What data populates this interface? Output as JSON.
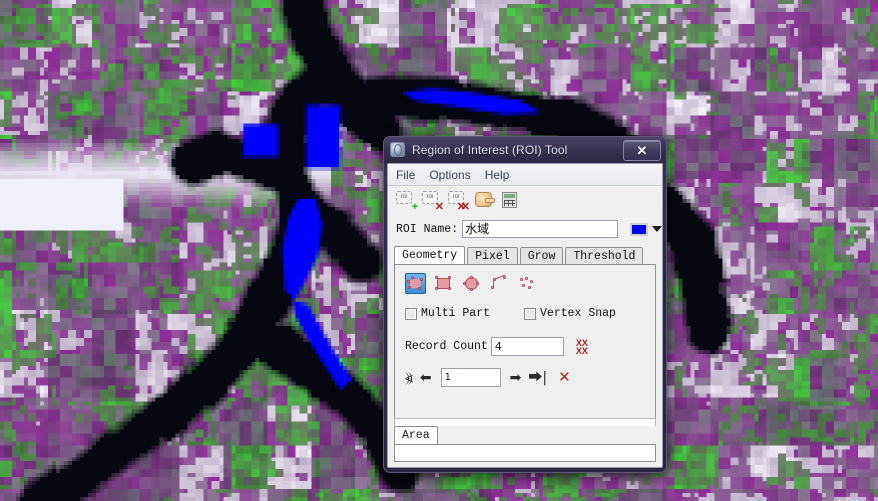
{
  "window": {
    "title": "Region of Interest (ROI) Tool",
    "app_icon": "globe-icon",
    "close_label": "✕"
  },
  "menubar": {
    "items": [
      {
        "label": "File"
      },
      {
        "label": "Options"
      },
      {
        "label": "Help"
      }
    ]
  },
  "toolbar": {
    "buttons": [
      {
        "name": "new-roi",
        "glyph": "roi",
        "badge": "+"
      },
      {
        "name": "delete-roi",
        "glyph": "roi",
        "badge": "✕"
      },
      {
        "name": "delete-all-roi",
        "glyph": "roi",
        "badge": "✕✕"
      },
      {
        "name": "pointer-hand",
        "glyph": "hand",
        "badge": ""
      },
      {
        "name": "statistics-calculator",
        "glyph": "calc",
        "badge": ""
      }
    ]
  },
  "roi_name": {
    "label": "ROI Name:",
    "value": "水域",
    "placeholder": "",
    "color": "#0000ff"
  },
  "tabs": {
    "items": [
      {
        "label": "Geometry",
        "active": true
      },
      {
        "label": "Pixel",
        "active": false
      },
      {
        "label": "Grow",
        "active": false
      },
      {
        "label": "Threshold",
        "active": false
      }
    ]
  },
  "geometry": {
    "shape_tools": [
      {
        "name": "polygon-tool",
        "selected": true
      },
      {
        "name": "rectangle-tool",
        "selected": false
      },
      {
        "name": "ellipse-tool",
        "selected": false
      },
      {
        "name": "polyline-tool",
        "selected": false
      },
      {
        "name": "points-tool",
        "selected": false
      }
    ],
    "multi_part": {
      "label": "Multi Part",
      "checked": false
    },
    "vertex_snap": {
      "label": "Vertex Snap",
      "checked": false
    },
    "record_count": {
      "label": "Record Count",
      "value": "4"
    },
    "clear_all_icon": "XX\nXX",
    "navigation": {
      "first_label": "⦖",
      "prev_label": "⬅",
      "index_value": "1",
      "next_label": "➡",
      "last_label": "⮕|",
      "delete_label": "✕"
    }
  },
  "bottom_tabs": {
    "items": [
      {
        "label": "Area",
        "active": true
      }
    ]
  },
  "colors": {
    "titlebar_start": "#4a4268",
    "titlebar_end": "#2b2744",
    "panel_bg": "#f0f0f0",
    "roi_blue": "#0000ff",
    "accent_red": "#b02020",
    "selected_tool_blue": "#3d8fd6"
  },
  "map": {
    "description": "false-color satellite image with dark water body and blue ROI polygons",
    "roi_polygon_color": "#0000ff"
  }
}
